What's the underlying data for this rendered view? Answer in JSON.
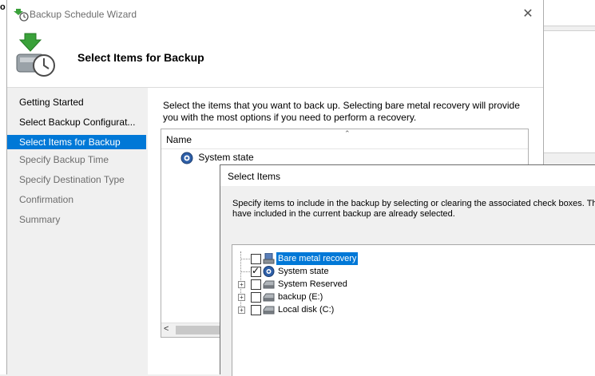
{
  "background": {
    "left_fragment": "o"
  },
  "wizard": {
    "title": "Backup Schedule Wizard",
    "close_glyph": "✕",
    "header_title": "Select Items for Backup",
    "nav": [
      {
        "label": "Getting Started",
        "state": "done"
      },
      {
        "label": "Select Backup Configurat...",
        "state": "done"
      },
      {
        "label": "Select Items for Backup",
        "state": "active"
      },
      {
        "label": "Specify Backup Time",
        "state": "pending"
      },
      {
        "label": "Specify Destination Type",
        "state": "pending"
      },
      {
        "label": "Confirmation",
        "state": "pending"
      },
      {
        "label": "Summary",
        "state": "pending"
      }
    ],
    "description_line1": "Select the items that you want to back up. Selecting bare metal recovery will provide",
    "description_line2": "you with the most options if you need to perform a recovery.",
    "list": {
      "column_name": "Name",
      "sort_glyph": "⌃",
      "items": [
        {
          "label": "System state",
          "icon": "system-state-icon"
        }
      ],
      "scroll_left_glyph": "<"
    },
    "accent_color": "#0078d7"
  },
  "dialog": {
    "title": "Select Items",
    "description_line1": "Specify items to include in the backup by selecting or clearing the associated check boxes. The i",
    "description_line2": "have included in the current backup are already selected.",
    "tree": [
      {
        "label": "Bare metal recovery",
        "checked": false,
        "expandable": false,
        "selected": true,
        "icon": "bare-metal-recovery-icon"
      },
      {
        "label": "System state",
        "checked": true,
        "expandable": false,
        "selected": false,
        "icon": "system-state-icon"
      },
      {
        "label": "System Reserved",
        "checked": false,
        "expandable": true,
        "selected": false,
        "icon": "drive-icon"
      },
      {
        "label": "backup (E:)",
        "checked": false,
        "expandable": true,
        "selected": false,
        "icon": "drive-icon"
      },
      {
        "label": "Local disk (C:)",
        "checked": false,
        "expandable": true,
        "selected": false,
        "icon": "drive-icon"
      }
    ]
  }
}
